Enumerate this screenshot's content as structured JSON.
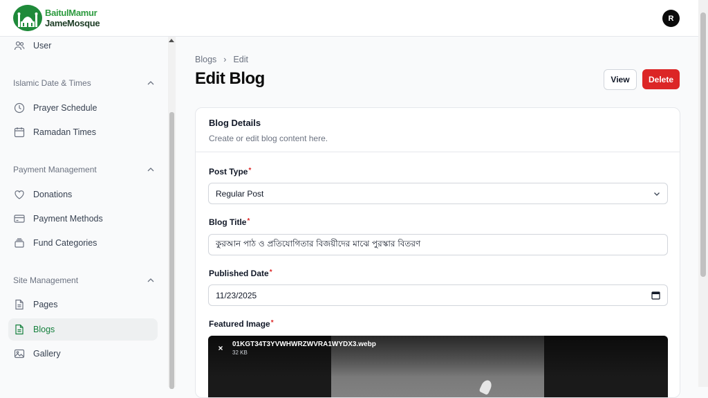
{
  "brand": {
    "line1": "BaitulMamur",
    "line2": "JameMosque"
  },
  "user": {
    "initial": "R"
  },
  "sidebar": {
    "items": [
      {
        "label": "User",
        "icon": "users-icon"
      }
    ],
    "groups": [
      {
        "title": "Islamic Date & Times",
        "items": [
          {
            "label": "Prayer Schedule",
            "icon": "clock-icon"
          },
          {
            "label": "Ramadan Times",
            "icon": "calendar-icon"
          }
        ]
      },
      {
        "title": "Payment Management",
        "items": [
          {
            "label": "Donations",
            "icon": "heart-icon"
          },
          {
            "label": "Payment Methods",
            "icon": "credit-card-icon"
          },
          {
            "label": "Fund Categories",
            "icon": "stack-icon"
          }
        ]
      },
      {
        "title": "Site Management",
        "items": [
          {
            "label": "Pages",
            "icon": "document-icon"
          },
          {
            "label": "Blogs",
            "icon": "blog-document-icon",
            "active": true
          },
          {
            "label": "Gallery",
            "icon": "image-icon"
          }
        ]
      }
    ]
  },
  "breadcrumb": {
    "parent": "Blogs",
    "current": "Edit",
    "separator": "›"
  },
  "page": {
    "title": "Edit Blog"
  },
  "actions": {
    "view_label": "View",
    "delete_label": "Delete"
  },
  "colors": {
    "accent": "#15803d",
    "danger": "#dc2626"
  },
  "card": {
    "title": "Blog Details",
    "description": "Create or edit blog content here."
  },
  "form": {
    "post_type": {
      "label": "Post Type",
      "value": "Regular Post"
    },
    "blog_title": {
      "label": "Blog Title",
      "value": "কুরআন পাঠ ও প্রতিযোগিতার বিজয়ীদের মাঝে পুরস্কার বিতরণ"
    },
    "published_date": {
      "label": "Published Date",
      "value": "11/23/2025"
    },
    "featured_image": {
      "label": "Featured Image",
      "file_name": "01KGT34T3YVWHWRZWVRA1WYDX3.webp",
      "file_size": "32 KB",
      "remove": "×"
    },
    "required_mark": "*"
  }
}
